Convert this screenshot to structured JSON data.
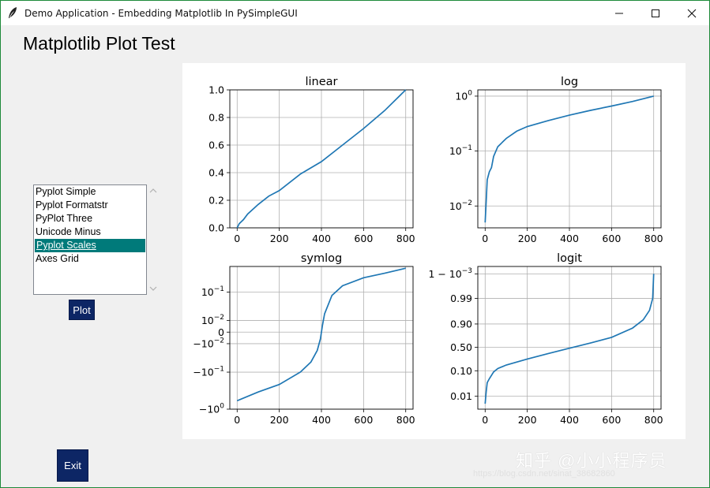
{
  "window": {
    "title": "Demo Application - Embedding Matplotlib In PySimpleGUI"
  },
  "heading": "Matplotlib Plot Test",
  "listbox": {
    "items": [
      "Pyplot Simple",
      "Pyplot Formatstr",
      "PyPlot Three",
      "Unicode Minus",
      "Pyplot Scales",
      "Axes Grid"
    ],
    "selected": "Pyplot Scales"
  },
  "buttons": {
    "plot": "Plot",
    "exit": "Exit"
  },
  "watermark": {
    "text": "知乎 @小小程序员",
    "url": "https://blog.csdn.net/sinat_38682860"
  },
  "colors": {
    "line": "#1f77b4",
    "selection": "#007a7a",
    "button": "#0d2665"
  },
  "chart_data": [
    {
      "type": "line",
      "title": "linear",
      "yscale": "linear",
      "grid": true,
      "xlim": [
        0,
        800
      ],
      "ylim": [
        0,
        1
      ],
      "xticks": [
        "0",
        "200",
        "400",
        "600",
        "800"
      ],
      "yticks": [
        "0.0",
        "0.2",
        "0.4",
        "0.6",
        "0.8",
        "1.0"
      ],
      "x": [
        0,
        10,
        30,
        50,
        100,
        150,
        200,
        300,
        400,
        500,
        600,
        700,
        800
      ],
      "y": [
        0.0,
        0.03,
        0.06,
        0.1,
        0.17,
        0.23,
        0.27,
        0.39,
        0.48,
        0.6,
        0.72,
        0.85,
        1.0
      ]
    },
    {
      "type": "line",
      "title": "log",
      "yscale": "log",
      "grid": true,
      "xlim": [
        0,
        800
      ],
      "ylim": [
        0.004,
        1.3
      ],
      "xticks": [
        "0",
        "200",
        "400",
        "600",
        "800"
      ],
      "yticks": [
        "10^-2",
        "10^-1",
        "10^0"
      ],
      "x": [
        0,
        5,
        10,
        20,
        30,
        40,
        60,
        100,
        150,
        200,
        300,
        400,
        500,
        600,
        700,
        800
      ],
      "y": [
        0.005,
        0.012,
        0.03,
        0.042,
        0.05,
        0.08,
        0.12,
        0.17,
        0.23,
        0.28,
        0.36,
        0.45,
        0.55,
        0.66,
        0.8,
        1.0
      ]
    },
    {
      "type": "line",
      "title": "symlog",
      "yscale": "symlog",
      "grid": true,
      "xlim": [
        0,
        800
      ],
      "ylim": [
        -1,
        0.5
      ],
      "xticks": [
        "0",
        "200",
        "400",
        "600",
        "800"
      ],
      "yticks": [
        "-10^0",
        "-10^-1",
        "-10^-2",
        "0",
        "10^-2",
        "10^-1"
      ],
      "x": [
        0,
        100,
        200,
        300,
        350,
        380,
        395,
        400,
        405,
        415,
        450,
        500,
        600,
        700,
        800
      ],
      "y": [
        -0.6,
        -0.35,
        -0.22,
        -0.1,
        -0.05,
        -0.02,
        -0.005,
        0.0,
        0.005,
        0.02,
        0.08,
        0.15,
        0.25,
        0.33,
        0.45
      ]
    },
    {
      "type": "line",
      "title": "logit",
      "yscale": "logit",
      "grid": true,
      "xlim": [
        0,
        800
      ],
      "ylim": [
        0.003,
        0.9995
      ],
      "xticks": [
        "0",
        "200",
        "400",
        "600",
        "800"
      ],
      "yticks": [
        "0.01",
        "0.10",
        "0.50",
        "0.90",
        "0.99",
        "1 − 10^-3"
      ],
      "x": [
        0,
        5,
        10,
        20,
        40,
        60,
        100,
        200,
        300,
        400,
        500,
        600,
        700,
        750,
        780,
        795,
        800
      ],
      "y": [
        0.005,
        0.015,
        0.035,
        0.05,
        0.09,
        0.12,
        0.16,
        0.25,
        0.36,
        0.48,
        0.6,
        0.72,
        0.86,
        0.93,
        0.97,
        0.99,
        0.999
      ]
    }
  ]
}
